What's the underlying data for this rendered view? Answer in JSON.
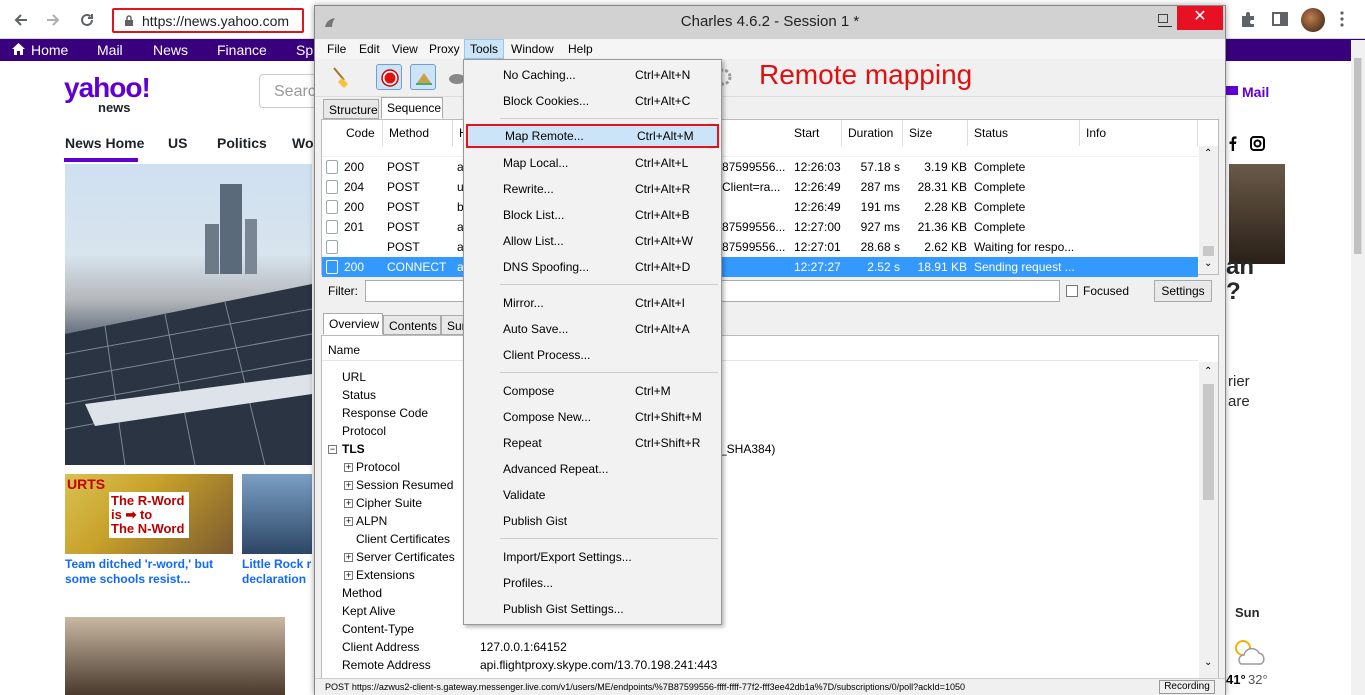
{
  "browser": {
    "url": "https://news.yahoo.com",
    "back_label": "←",
    "forward_label": "→",
    "reload_label": "↻"
  },
  "yahoo": {
    "nav": [
      "Home",
      "Mail",
      "News",
      "Finance",
      "Sp"
    ],
    "logo_main": "yahoo!",
    "logo_sub": "news",
    "search_placeholder": "Searc",
    "tabs": [
      "News Home",
      "US",
      "Politics",
      "Wo"
    ],
    "mail_label": "Mail",
    "captions": {
      "first": [
        "Team ditched 'r-word,' but",
        "some schools resist..."
      ],
      "second": [
        "Little Rock r",
        "declaration"
      ]
    },
    "sign_text": [
      "URTS",
      "The R-Word",
      "is ➡ to",
      "The N-Word"
    ],
    "right_partial": [
      "an",
      "?",
      "rier",
      "are"
    ],
    "weather_day": "Sun",
    "weather_hi": "41°",
    "weather_lo": "32°"
  },
  "charles": {
    "title": "Charles 4.6.2 - Session 1 *",
    "menubar": [
      "File",
      "Edit",
      "View",
      "Proxy",
      "Tools",
      "Window",
      "Help"
    ],
    "annotation": "Remote mapping",
    "tabs": [
      "Structure",
      "Sequence"
    ],
    "columns": [
      "Code",
      "Method",
      "H",
      "Start",
      "Duration",
      "Size",
      "Status",
      "Info"
    ],
    "rows": [
      {
        "code": "200",
        "method": "POST",
        "host": "az",
        "path": "87599556...",
        "start": "12:26:03",
        "duration": "57.18 s",
        "size": "3.19 KB",
        "status": "Complete",
        "selected": false
      },
      {
        "code": "204",
        "method": "POST",
        "host": "u",
        "path": "Client=ra...",
        "start": "12:26:49",
        "duration": "287 ms",
        "size": "28.31 KB",
        "status": "Complete",
        "selected": false
      },
      {
        "code": "200",
        "method": "POST",
        "host": "b",
        "path": "",
        "start": "12:26:49",
        "duration": "191 ms",
        "size": "2.28 KB",
        "status": "Complete",
        "selected": false
      },
      {
        "code": "201",
        "method": "POST",
        "host": "az",
        "path": "87599556...",
        "start": "12:27:00",
        "duration": "927 ms",
        "size": "21.36 KB",
        "status": "Complete",
        "selected": false
      },
      {
        "code": "",
        "method": "POST",
        "host": "az",
        "path": "87599556...",
        "start": "12:27:01",
        "duration": "28.68 s",
        "size": "2.62 KB",
        "status": "Waiting for respo...",
        "selected": false
      },
      {
        "code": "200",
        "method": "CONNECT",
        "host": "ar",
        "path": "",
        "start": "12:27:27",
        "duration": "2.52 s",
        "size": "18.91 KB",
        "status": "Sending request ...",
        "selected": true
      }
    ],
    "filter_label": "Filter:",
    "focused_label": "Focused",
    "settings_label": "Settings",
    "detail_tabs": [
      "Overview",
      "Contents",
      "Sur"
    ],
    "overview": {
      "name_header": "Name",
      "rows": [
        {
          "label": "URL",
          "indent": 1,
          "expander": "",
          "value": ""
        },
        {
          "label": "Status",
          "indent": 1,
          "expander": "",
          "value": ""
        },
        {
          "label": "Response Code",
          "indent": 1,
          "expander": "",
          "value": ""
        },
        {
          "label": "Protocol",
          "indent": 1,
          "expander": "",
          "value": ""
        },
        {
          "label": "TLS",
          "indent": 0,
          "expander": "−",
          "value": "_SHA384)"
        },
        {
          "label": "Protocol",
          "indent": 2,
          "expander": "+",
          "value": ""
        },
        {
          "label": "Session Resumed",
          "indent": 2,
          "expander": "+",
          "value": ""
        },
        {
          "label": "Cipher Suite",
          "indent": 2,
          "expander": "+",
          "value": ""
        },
        {
          "label": "ALPN",
          "indent": 2,
          "expander": "+",
          "value": ""
        },
        {
          "label": "Client Certificates",
          "indent": 2,
          "expander": "",
          "value": ""
        },
        {
          "label": "Server Certificates",
          "indent": 2,
          "expander": "+",
          "value": ""
        },
        {
          "label": "Extensions",
          "indent": 2,
          "expander": "+",
          "value": ""
        },
        {
          "label": "Method",
          "indent": 1,
          "expander": "",
          "value": ""
        },
        {
          "label": "Kept Alive",
          "indent": 1,
          "expander": "",
          "value": ""
        },
        {
          "label": "Content-Type",
          "indent": 1,
          "expander": "",
          "value": ""
        },
        {
          "label": "Client Address",
          "indent": 1,
          "expander": "",
          "value": "127.0.0.1:64152"
        },
        {
          "label": "Remote Address",
          "indent": 1,
          "expander": "",
          "value": "api.flightproxy.skype.com/13.70.198.241:443"
        }
      ]
    },
    "status_text": "POST https://azwus2-client-s.gateway.messenger.live.com/v1/users/ME/endpoints/%7B87599556-ffff-ffff-77f2-fff3ee42db1a%7D/subscriptions/0/poll?ackId=1050",
    "recording_label": "Recording"
  },
  "tools_menu": {
    "items": [
      {
        "label": "No Caching...",
        "shortcut": "Ctrl+Alt+N",
        "highlight": false,
        "sep_before": false
      },
      {
        "label": "Block Cookies...",
        "shortcut": "Ctrl+Alt+C",
        "highlight": false,
        "sep_before": false
      },
      {
        "label": "Map Remote...",
        "shortcut": "Ctrl+Alt+M",
        "highlight": true,
        "sep_before": true
      },
      {
        "label": "Map Local...",
        "shortcut": "Ctrl+Alt+L",
        "highlight": false,
        "sep_before": false
      },
      {
        "label": "Rewrite...",
        "shortcut": "Ctrl+Alt+R",
        "highlight": false,
        "sep_before": false
      },
      {
        "label": "Block List...",
        "shortcut": "Ctrl+Alt+B",
        "highlight": false,
        "sep_before": false
      },
      {
        "label": "Allow List...",
        "shortcut": "Ctrl+Alt+W",
        "highlight": false,
        "sep_before": false
      },
      {
        "label": "DNS Spoofing...",
        "shortcut": "Ctrl+Alt+D",
        "highlight": false,
        "sep_before": false
      },
      {
        "label": "Mirror...",
        "shortcut": "Ctrl+Alt+I",
        "highlight": false,
        "sep_before": true
      },
      {
        "label": "Auto Save...",
        "shortcut": "Ctrl+Alt+A",
        "highlight": false,
        "sep_before": false
      },
      {
        "label": "Client Process...",
        "shortcut": "",
        "highlight": false,
        "sep_before": false
      },
      {
        "label": "Compose",
        "shortcut": "Ctrl+M",
        "highlight": false,
        "sep_before": true
      },
      {
        "label": "Compose New...",
        "shortcut": "Ctrl+Shift+M",
        "highlight": false,
        "sep_before": false
      },
      {
        "label": "Repeat",
        "shortcut": "Ctrl+Shift+R",
        "highlight": false,
        "sep_before": false
      },
      {
        "label": "Advanced Repeat...",
        "shortcut": "",
        "highlight": false,
        "sep_before": false
      },
      {
        "label": "Validate",
        "shortcut": "",
        "highlight": false,
        "sep_before": false
      },
      {
        "label": "Publish Gist",
        "shortcut": "",
        "highlight": false,
        "sep_before": false
      },
      {
        "label": "Import/Export Settings...",
        "shortcut": "",
        "highlight": false,
        "sep_before": true
      },
      {
        "label": "Profiles...",
        "shortcut": "",
        "highlight": false,
        "sep_before": false
      },
      {
        "label": "Publish Gist Settings...",
        "shortcut": "",
        "highlight": false,
        "sep_before": false
      }
    ]
  },
  "colors": {
    "yahoo_purple": "#6001d2",
    "yahoo_nav": "#39007d",
    "annotation_red": "#e0141b",
    "selection_blue": "#3399ff"
  }
}
